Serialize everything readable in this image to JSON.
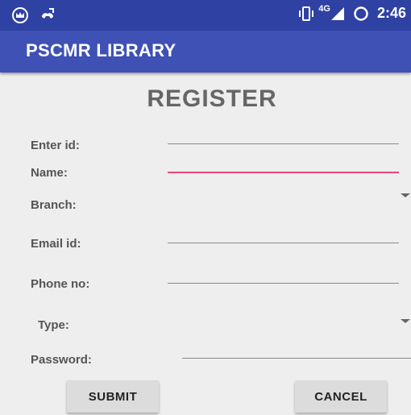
{
  "status_bar": {
    "icons": [
      "crown-notification-icon",
      "missed-call-icon",
      "vibrate-icon",
      "signal-icon",
      "sync-icon"
    ],
    "network_label": "4G",
    "time": "2:46"
  },
  "app_bar": {
    "title": "PSCMR LIBRARY"
  },
  "form": {
    "title": "REGISTER",
    "fields": {
      "id": {
        "label": "Enter id:",
        "value": ""
      },
      "name": {
        "label": "Name:",
        "value": ""
      },
      "branch": {
        "label": "Branch:",
        "selected": ""
      },
      "email": {
        "label": "Email id:",
        "value": ""
      },
      "phone": {
        "label": "Phone no:",
        "value": ""
      },
      "type": {
        "label": "Type:",
        "selected": ""
      },
      "password": {
        "label": "Password:",
        "value": ""
      }
    },
    "submit_label": "SUBMIT",
    "cancel_label": "CANCEL"
  },
  "colors": {
    "status_bar": "#2f41a3",
    "app_bar": "#3f51b5",
    "background": "#eeeeee",
    "focus_accent": "#e8457d"
  }
}
